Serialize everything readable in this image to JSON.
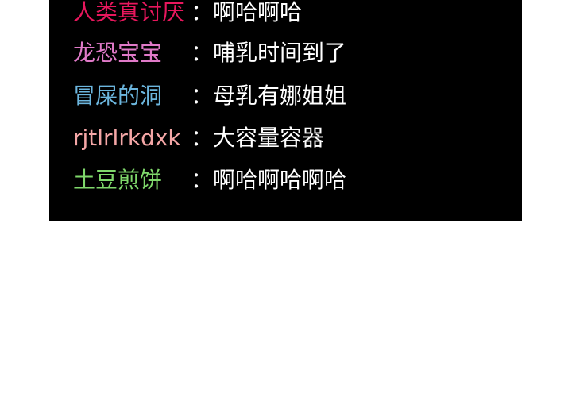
{
  "chat": {
    "separator": "：",
    "lines": [
      {
        "speaker": "人类真讨厌",
        "message": "啊哈啊哈",
        "color": "#e8175d"
      },
      {
        "speaker": "龙恐宝宝",
        "message": "哺乳时间到了",
        "color": "#e07ac8"
      },
      {
        "speaker": "冒屎的洞",
        "message": "母乳有娜姐姐",
        "color": "#6cb6de"
      },
      {
        "speaker": "rjtlrlrkdxk",
        "message": "大容量容器",
        "color": "#f4a6a6"
      },
      {
        "speaker": "土豆煎饼",
        "message": "啊哈啊哈啊哈",
        "color": "#7fd86b"
      }
    ]
  }
}
